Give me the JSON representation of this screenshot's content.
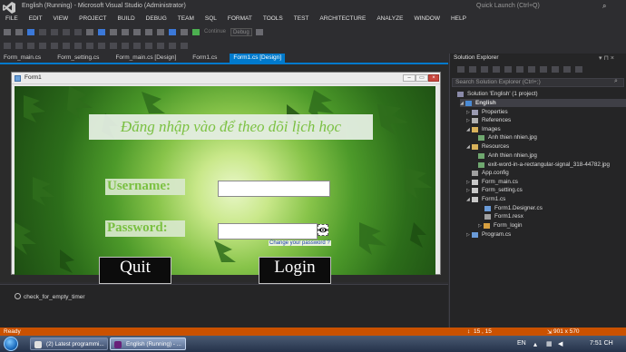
{
  "window": {
    "title": "English (Running) - Microsoft Visual Studio (Administrator)",
    "quick_launch_placeholder": "Quick Launch (Ctrl+Q)"
  },
  "menu": [
    "FILE",
    "EDIT",
    "VIEW",
    "PROJECT",
    "BUILD",
    "DEBUG",
    "TEAM",
    "SQL",
    "FORMAT",
    "TOOLS",
    "TEST",
    "ARCHITECTURE",
    "ANALYZE",
    "WINDOW",
    "HELP"
  ],
  "toolbar": {
    "continue_label": "Continue",
    "config_value": "Debug"
  },
  "doc_tabs": [
    {
      "label": "Form_main.cs",
      "active": false
    },
    {
      "label": "Form_setting.cs",
      "active": false
    },
    {
      "label": "Form_main.cs [Design]",
      "active": false
    },
    {
      "label": "Form1.cs",
      "active": false
    },
    {
      "label": "Form1.cs [Design]",
      "active": true
    }
  ],
  "form": {
    "title": "Form1",
    "banner": "Đăng nhập vào để theo dõi lịch học",
    "username_label": "Username:",
    "password_label": "Password:",
    "username_value": "",
    "password_value": "",
    "change_password": "Change your password ?",
    "quit_button": "Quit",
    "login_button": "Login"
  },
  "component_tray": {
    "timer_name": "check_for_empty_timer"
  },
  "solution_explorer": {
    "title": "Solution Explorer",
    "search_placeholder": "Search Solution Explorer (Ctrl+;)",
    "items": [
      {
        "label": "Solution 'English' (1 project)",
        "level": 0
      },
      {
        "label": "English",
        "level": 1,
        "bold": true
      },
      {
        "label": "Properties",
        "level": 2
      },
      {
        "label": "References",
        "level": 2
      },
      {
        "label": "Images",
        "level": 2
      },
      {
        "label": "Anh thien nhien.jpg",
        "level": 3
      },
      {
        "label": "Resources",
        "level": 2
      },
      {
        "label": "Anh thien nhien.jpg",
        "level": 3
      },
      {
        "label": "exit-word-in-a-rectangular-signal_318-44782.jpg",
        "level": 3
      },
      {
        "label": "App.config",
        "level": 2
      },
      {
        "label": "Form_main.cs",
        "level": 2
      },
      {
        "label": "Form_setting.cs",
        "level": 2
      },
      {
        "label": "Form1.cs",
        "level": 2
      },
      {
        "label": "Form1.Designer.cs",
        "level": 3
      },
      {
        "label": "Form1.resx",
        "level": 3
      },
      {
        "label": "Form_login",
        "level": 3
      },
      {
        "label": "Program.cs",
        "level": 2
      }
    ]
  },
  "status": {
    "left": "Ready",
    "position": "15 , 15",
    "size": "901 x 570"
  },
  "taskbar": {
    "buttons": [
      "(2) Latest programmi...",
      "English (Running) - ..."
    ],
    "language": "EN",
    "time": "7:51 CH"
  },
  "colors": {
    "accent": "#007acc",
    "statusbar": "#ca5100",
    "label_green": "#7cc243"
  }
}
